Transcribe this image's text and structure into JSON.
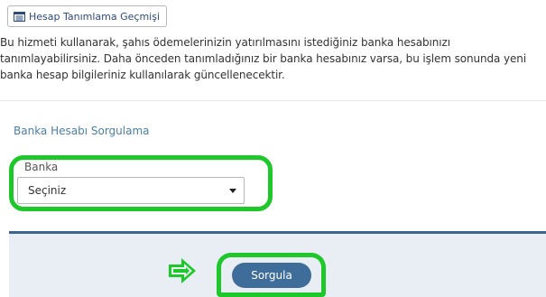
{
  "toolbar": {
    "history_button_label": "Hesap Tanımlama Geçmişi",
    "history_icon": "list-table-icon"
  },
  "intro_text": "Bu hizmeti kullanarak, şahıs ödemelerinizin yatırılmasını istediğiniz banka hesabınızı tanımlayabilirsiniz. Daha önceden tanımladığınız bir banka hesabınız varsa, bu işlem sonunda yeni banka hesap bilgileriniz kullanılarak güncellenecektir.",
  "section": {
    "title": "Banka Hesabı Sorgulama"
  },
  "bank_field": {
    "label": "Banka",
    "selected_value": "Seçiniz"
  },
  "actions": {
    "query_button_label": "Sorgula"
  },
  "colors": {
    "highlight": "#1ec82a",
    "button_primary": "#3f6d99",
    "panel_background": "#e9edf4",
    "section_title": "#4a7fa8"
  }
}
